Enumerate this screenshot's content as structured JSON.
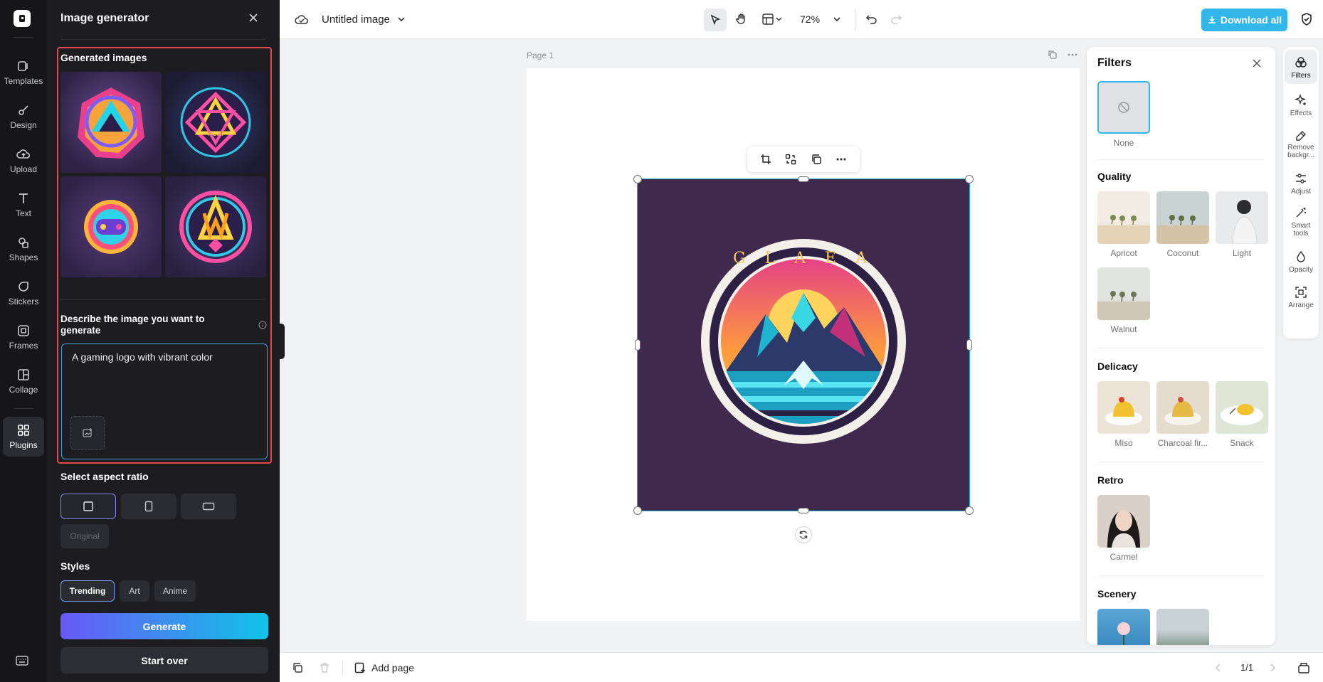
{
  "rail": {
    "items": [
      {
        "label": "Templates"
      },
      {
        "label": "Design"
      },
      {
        "label": "Upload"
      },
      {
        "label": "Text"
      },
      {
        "label": "Shapes"
      },
      {
        "label": "Stickers"
      },
      {
        "label": "Frames"
      },
      {
        "label": "Collage"
      },
      {
        "label": "Plugins"
      }
    ]
  },
  "generator": {
    "title": "Image generator",
    "generated_label": "Generated images",
    "describe_label": "Describe the image you want to generate",
    "prompt_value": "A gaming logo with vibrant color",
    "aspect_label": "Select aspect ratio",
    "aspect_original": "Original",
    "styles_label": "Styles",
    "styles": [
      "Trending",
      "Art",
      "Anime"
    ],
    "selected_style": "Trending",
    "generate_label": "Generate",
    "start_over_label": "Start over"
  },
  "topbar": {
    "doc_title": "Untitled image",
    "zoom": "72%",
    "download_label": "Download all"
  },
  "canvas": {
    "page_label": "Page 1",
    "logo_text": "G L A E A"
  },
  "bottombar": {
    "add_page_label": "Add page",
    "page_counter": "1/1"
  },
  "filters": {
    "title": "Filters",
    "none_label": "None",
    "sections": [
      {
        "title": "Quality",
        "items": [
          "Apricot",
          "Coconut",
          "Light",
          "Walnut"
        ]
      },
      {
        "title": "Delicacy",
        "items": [
          "Miso",
          "Charcoal fir...",
          "Snack"
        ]
      },
      {
        "title": "Retro",
        "items": [
          "Carmel"
        ]
      },
      {
        "title": "Scenery",
        "items": []
      }
    ]
  },
  "tools": [
    {
      "label": "Filters"
    },
    {
      "label": "Effects"
    },
    {
      "label": "Remove backgr..."
    },
    {
      "label": "Adjust"
    },
    {
      "label": "Smart tools"
    },
    {
      "label": "Opacity"
    },
    {
      "label": "Arrange"
    }
  ],
  "colors": {
    "accent": "#33b6ea",
    "highlight": "#e5484d",
    "selection": "#22b5d9"
  }
}
